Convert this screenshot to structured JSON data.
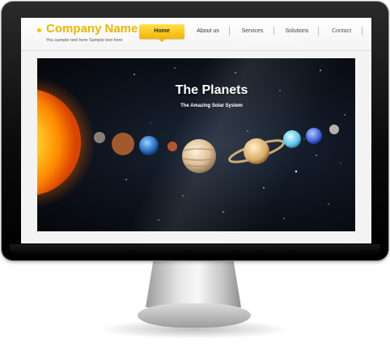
{
  "header": {
    "brand": "Company Name",
    "tagline": "You sample text here Sample text here"
  },
  "nav": {
    "items": [
      "Home",
      "About us",
      "Services",
      "Solutions",
      "Contact"
    ],
    "active": "Home"
  },
  "hero": {
    "title": "The Planets",
    "subtitle": "The Amazing Solar System"
  },
  "colors": {
    "accent": "#f2b400",
    "space": "#0d131d"
  }
}
